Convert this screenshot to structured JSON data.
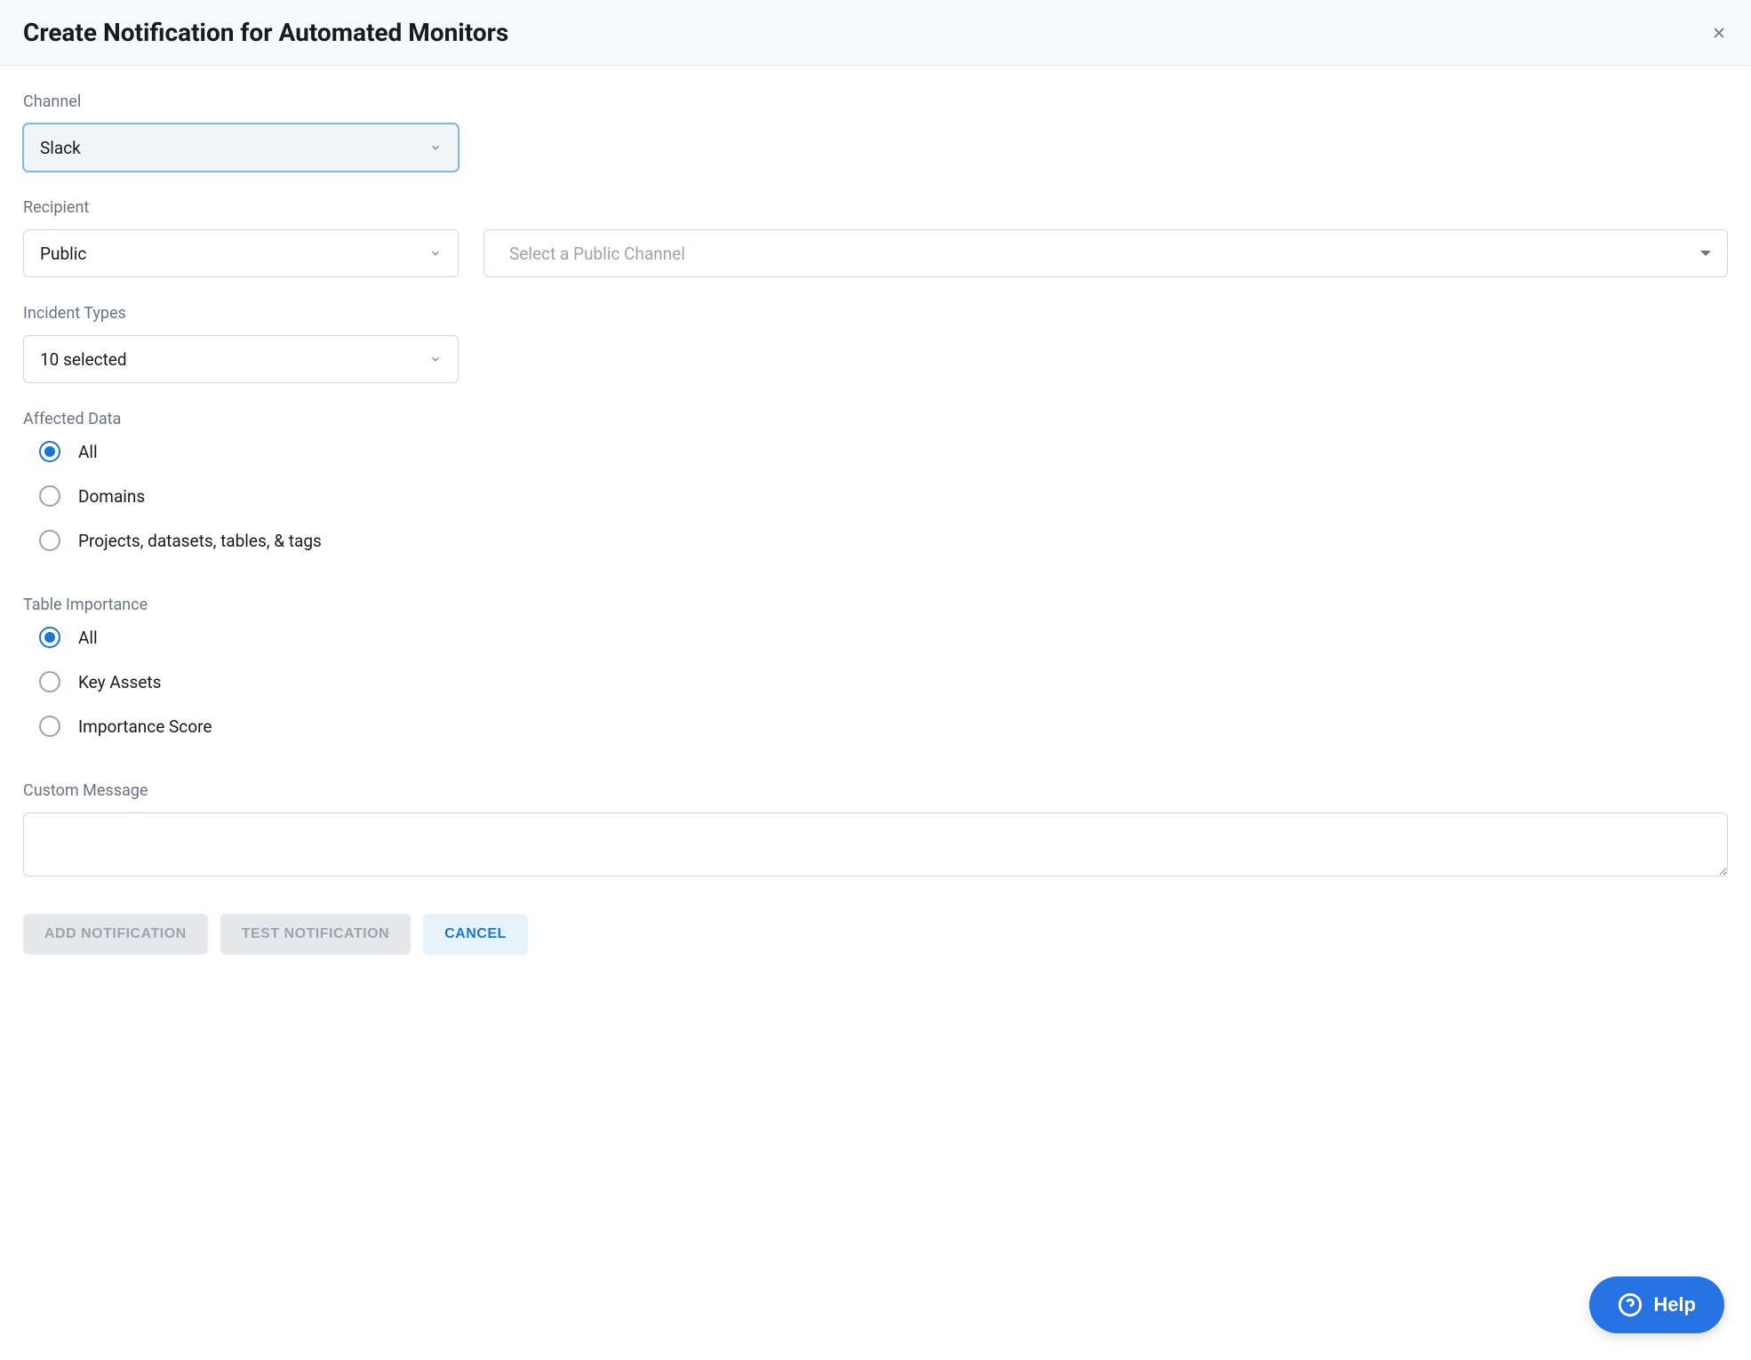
{
  "header": {
    "title": "Create Notification for Automated Monitors"
  },
  "channel": {
    "label": "Channel",
    "value": "Slack"
  },
  "recipient": {
    "label": "Recipient",
    "visibility_value": "Public",
    "channel_placeholder": "Select a Public Channel"
  },
  "incident_types": {
    "label": "Incident Types",
    "value": "10 selected"
  },
  "affected_data": {
    "label": "Affected Data",
    "options": [
      {
        "label": "All",
        "checked": true
      },
      {
        "label": "Domains",
        "checked": false
      },
      {
        "label": "Projects, datasets, tables, & tags",
        "checked": false
      }
    ]
  },
  "table_importance": {
    "label": "Table Importance",
    "options": [
      {
        "label": "All",
        "checked": true
      },
      {
        "label": "Key Assets",
        "checked": false
      },
      {
        "label": "Importance Score",
        "checked": false
      }
    ]
  },
  "custom_message": {
    "label": "Custom Message",
    "value": ""
  },
  "footer": {
    "add_label": "ADD NOTIFICATION",
    "test_label": "TEST NOTIFICATION",
    "cancel_label": "CANCEL"
  },
  "help": {
    "label": "Help"
  }
}
